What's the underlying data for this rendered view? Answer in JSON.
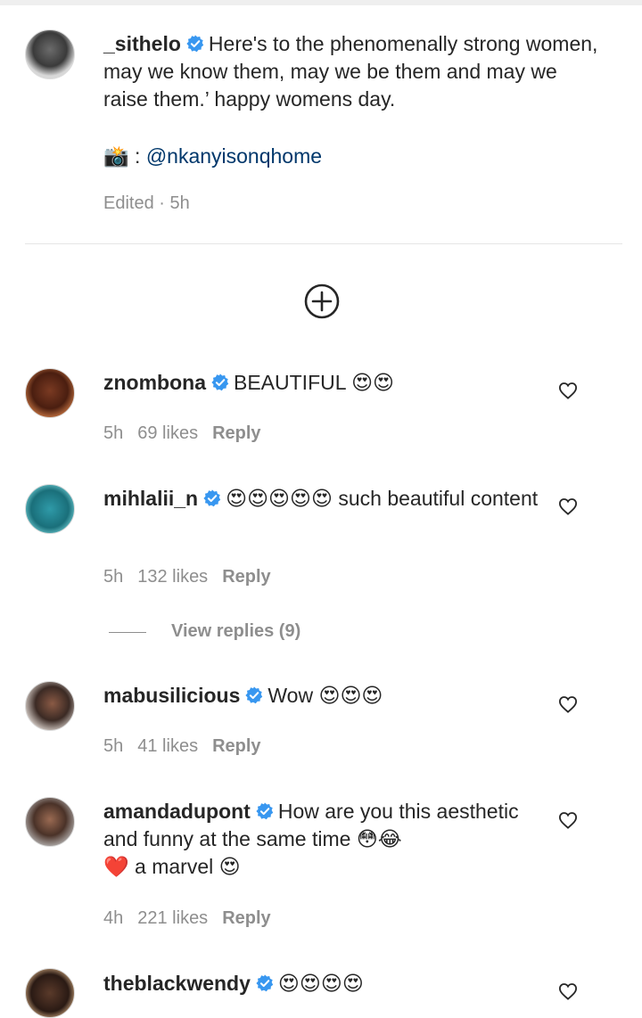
{
  "caption": {
    "username": "_sithelo",
    "text": "Here's to the phenomenally strong women, may we know them, may we be them and may we raise them.’ happy womens day.",
    "camera_emoji": "📸",
    "credit_separator": " : ",
    "credit": "@nkanyisonqhome",
    "edited": "Edited · 5h"
  },
  "comments": [
    {
      "username": "znombona",
      "text": "BEAUTIFUL",
      "emojis": "😍😍",
      "time": "5h",
      "likes": "69 likes",
      "reply": "Reply"
    },
    {
      "username": "mihlalii_n",
      "emojis": "😍😍😍😍😍",
      "text": "such beautiful content",
      "time": "5h",
      "likes": "132 likes",
      "reply": "Reply",
      "view_replies": "View replies (9)"
    },
    {
      "username": "mabusilicious",
      "text": "Wow",
      "emojis": "😍😍😍",
      "time": "5h",
      "likes": "41 likes",
      "reply": "Reply"
    },
    {
      "username": "amandadupont",
      "text": "How are you this aesthetic and funny at the same time",
      "emojis": "😳😂",
      "text2": "a marvel",
      "heart_emoji": "❤️",
      "emoji_end": "😍",
      "time": "4h",
      "likes": "221 likes",
      "reply": "Reply"
    },
    {
      "username": "theblackwendy",
      "emojis": "😍😍😍😍"
    }
  ],
  "colors": {
    "verified": "#3897f0",
    "mention": "#00376b",
    "meta": "#8e8e8e"
  }
}
